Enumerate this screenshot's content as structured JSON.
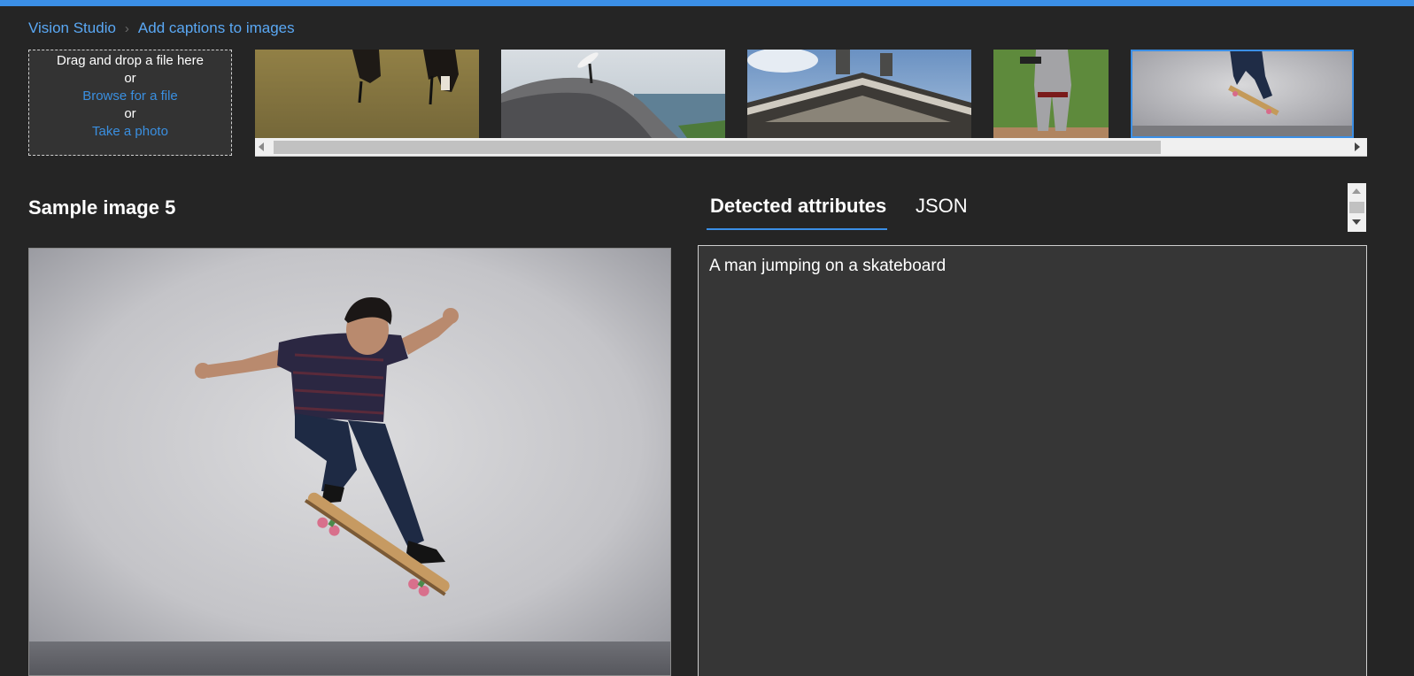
{
  "breadcrumb": {
    "root": "Vision Studio",
    "current": "Add captions to images"
  },
  "upload": {
    "drag_text": "Drag and drop a file here",
    "or_1": "or",
    "browse_link": "Browse for a file",
    "or_2": "or",
    "photo_link": "Take a photo"
  },
  "thumbnails": [
    {
      "name": "cows-grazing",
      "selected": false
    },
    {
      "name": "surfer-on-rock",
      "selected": false
    },
    {
      "name": "building-statues",
      "selected": false
    },
    {
      "name": "baseball-player",
      "selected": false
    },
    {
      "name": "skateboarder",
      "selected": true
    }
  ],
  "sample": {
    "title": "Sample image 5"
  },
  "tabs": [
    {
      "label": "Detected attributes",
      "active": true
    },
    {
      "label": "JSON",
      "active": false
    }
  ],
  "result": {
    "caption": "A man jumping on a skateboard"
  },
  "colors": {
    "accent": "#3b8fe6",
    "link": "#5aa8f4",
    "background": "#252525",
    "panel": "#363636"
  }
}
